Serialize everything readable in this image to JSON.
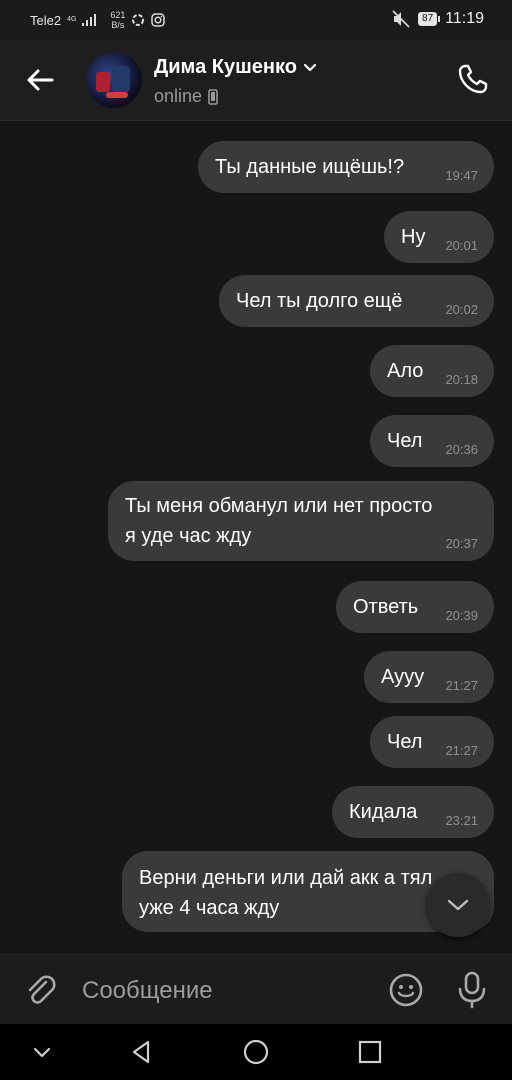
{
  "status_bar": {
    "carrier": "Tele2",
    "network": "4G",
    "speed_value": "621",
    "speed_unit": "B/s",
    "battery": "87",
    "time": "11:19"
  },
  "header": {
    "contact_name": "Дима Кушенко",
    "status": "online"
  },
  "messages": [
    {
      "text": "Ты данные ищёшь!?",
      "time": "19:47"
    },
    {
      "text": "Ну",
      "time": "20:01"
    },
    {
      "text": "Чел ты долго ещё",
      "time": "20:02"
    },
    {
      "text": "Ало",
      "time": "20:18"
    },
    {
      "text": "Чел",
      "time": "20:36"
    },
    {
      "text": "Ты меня обманул или нет просто",
      "text2": "я уде час жду",
      "time": "20:37"
    },
    {
      "text": "Ответь",
      "time": "20:39"
    },
    {
      "text": "Аууу",
      "time": "21:27"
    },
    {
      "text": "Чел",
      "time": "21:27"
    },
    {
      "text": "Кидала",
      "time": "23:21"
    },
    {
      "text": "Верни деньги или дай акк а т",
      "text2": "уже 4 часа жду",
      "suffix": "ял"
    }
  ],
  "composer": {
    "placeholder": "Сообщение"
  },
  "colors": {
    "background": "#161616",
    "bubble": "#3a3a3a",
    "time_text": "#8f8f8f"
  }
}
